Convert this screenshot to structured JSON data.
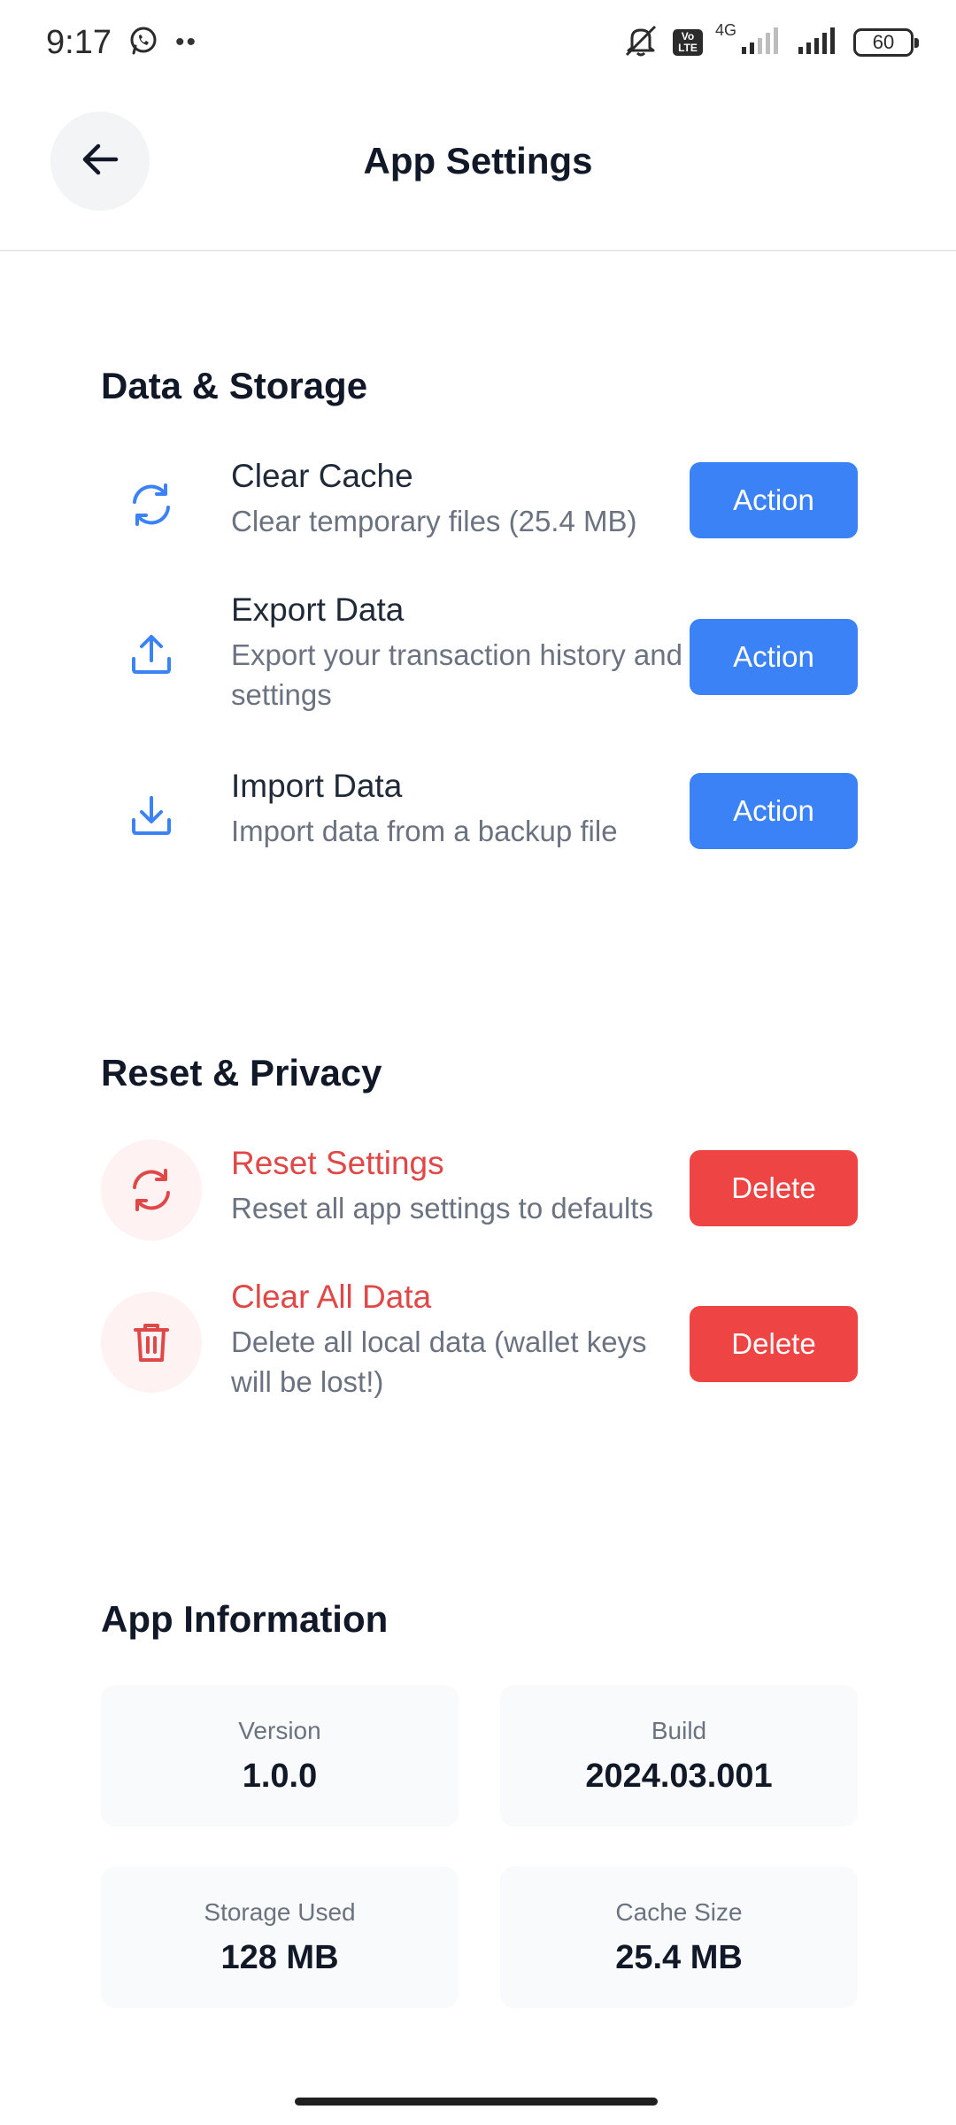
{
  "status_bar": {
    "time": "9:17",
    "dots": "••",
    "network": "4G",
    "lte_badge": "Vo\nLTE",
    "battery": "60"
  },
  "header": {
    "title": "App Settings"
  },
  "sections": {
    "data_storage": {
      "title": "Data & Storage",
      "items": [
        {
          "title": "Clear Cache",
          "description": "Clear temporary files (25.4 MB)",
          "button": "Action",
          "icon": "refresh-icon"
        },
        {
          "title": "Export Data",
          "description": "Export your transaction history and settings",
          "button": "Action",
          "icon": "upload-icon"
        },
        {
          "title": "Import Data",
          "description": "Import data from a backup file",
          "button": "Action",
          "icon": "download-icon"
        }
      ]
    },
    "reset_privacy": {
      "title": "Reset & Privacy",
      "items": [
        {
          "title": "Reset Settings",
          "description": "Reset all app settings to defaults",
          "button": "Delete",
          "icon": "refresh-icon"
        },
        {
          "title": "Clear All Data",
          "description": "Delete all local data (wallet keys will be lost!)",
          "button": "Delete",
          "icon": "trash-icon"
        }
      ]
    },
    "app_info": {
      "title": "App Information",
      "cards": [
        {
          "label": "Version",
          "value": "1.0.0"
        },
        {
          "label": "Build",
          "value": "2024.03.001"
        },
        {
          "label": "Storage Used",
          "value": "128 MB"
        },
        {
          "label": "Cache Size",
          "value": "25.4 MB"
        }
      ]
    }
  },
  "colors": {
    "primary": "#3b82f6",
    "danger": "#ef4444",
    "danger_text": "#e04848",
    "danger_bg": "#fef2f2"
  }
}
